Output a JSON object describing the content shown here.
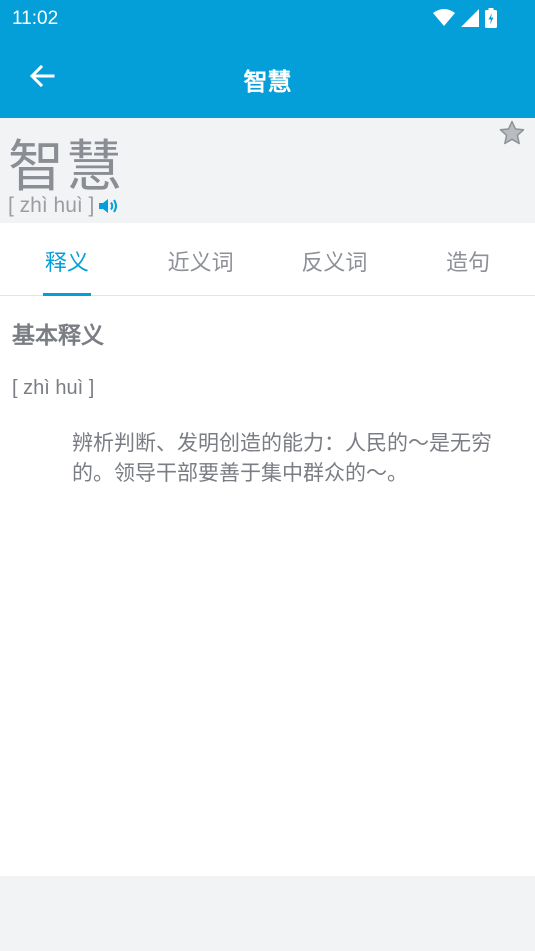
{
  "status_bar": {
    "time": "11:02",
    "icons": [
      "wifi-icon",
      "signal-icon",
      "battery-icon"
    ]
  },
  "app_bar": {
    "title": "智慧",
    "back_icon": "arrow-left-icon"
  },
  "entry": {
    "word": "智慧",
    "pinyin": "[ zhì huì ]",
    "speaker_icon": "speaker-icon",
    "favorite_icon": "star-icon"
  },
  "tabs": [
    {
      "label": "释义",
      "active": true
    },
    {
      "label": "近义词",
      "active": false
    },
    {
      "label": "反义词",
      "active": false
    },
    {
      "label": "造句",
      "active": false
    }
  ],
  "definition": {
    "section_title": "基本释义",
    "pinyin": "[ zhì huì ]",
    "text": "辨析判断、发明创造的能力：人民的～是无穷的。领导干部要善于集中群众的～。"
  },
  "colors": {
    "accent": "#049fd9",
    "text_gray": "#7a7d83",
    "background": "#f2f3f5"
  }
}
